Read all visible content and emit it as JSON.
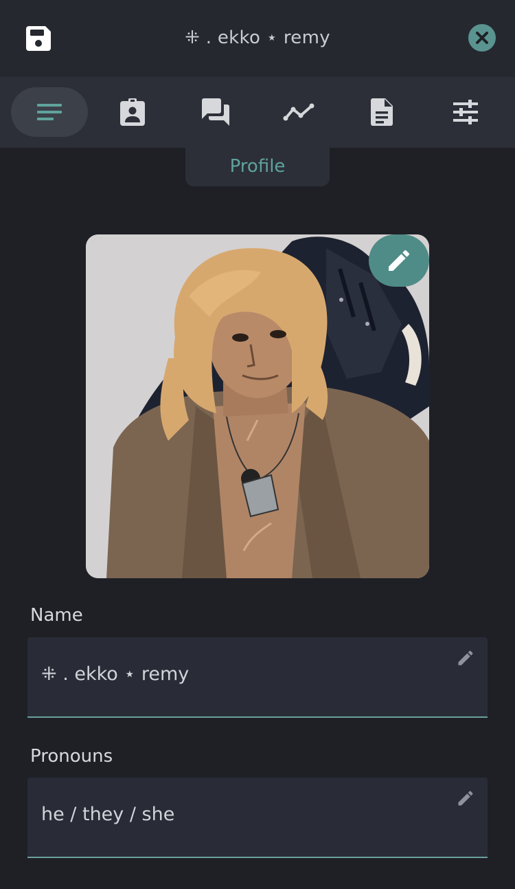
{
  "header": {
    "title": "⁜ . ekko ⋆ remy",
    "save_icon": "save-icon",
    "close_icon": "close-icon"
  },
  "tabs": [
    {
      "name": "profile",
      "icon": "notes-icon",
      "active": true
    },
    {
      "name": "badge",
      "icon": "contact-badge-icon",
      "active": false
    },
    {
      "name": "chat",
      "icon": "chat-bubbles-icon",
      "active": false
    },
    {
      "name": "stats",
      "icon": "line-chart-icon",
      "active": false
    },
    {
      "name": "document",
      "icon": "document-icon",
      "active": false
    },
    {
      "name": "settings",
      "icon": "sliders-icon",
      "active": false
    }
  ],
  "active_tab_label": "Profile",
  "profile": {
    "name_label": "Name",
    "name_value": "⁜ . ekko ⋆ remy",
    "pronouns_label": "Pronouns",
    "pronouns_value": "he / they / she"
  },
  "colors": {
    "accent": "#5fa39d",
    "background": "#1f2026",
    "header": "#262830",
    "field": "#292c36"
  }
}
